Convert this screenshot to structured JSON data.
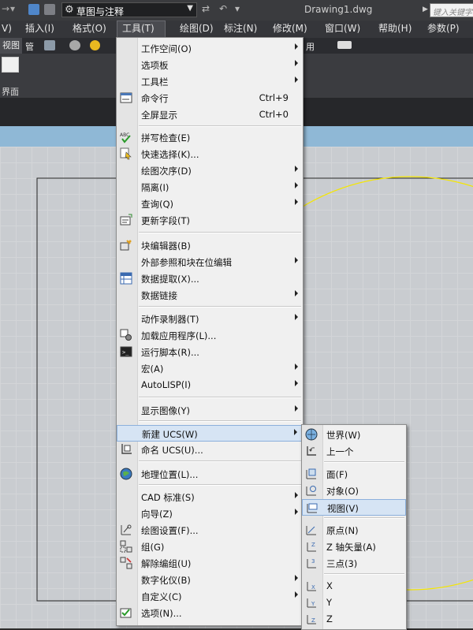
{
  "titlebar": {
    "workspace": "草图与注释",
    "doc_title": "Drawing1.dwg",
    "search_placeholder": "键入关键字"
  },
  "menubar": {
    "items": [
      {
        "label": "V)"
      },
      {
        "label": "插入(I)"
      },
      {
        "label": "格式(O)"
      },
      {
        "label": "工具(T)"
      },
      {
        "label": "绘图(D)"
      },
      {
        "label": "标注(N)"
      },
      {
        "label": "修改(M)"
      },
      {
        "label": "窗口(W)"
      },
      {
        "label": "帮助(H)"
      },
      {
        "label": "参数(P)"
      }
    ]
  },
  "ribbon": {
    "tab_left": "视图",
    "tab_manage": "管",
    "tab_use": "用",
    "panel_label": "界面"
  },
  "tools_menu": [
    {
      "label": "工作空间(O)",
      "arrow": true
    },
    {
      "label": "选项板",
      "arrow": true
    },
    {
      "label": "工具栏",
      "arrow": true
    },
    {
      "label": "命令行",
      "shortcut": "Ctrl+9",
      "icon": "command-line-icon"
    },
    {
      "label": "全屏显示",
      "shortcut": "Ctrl+0"
    },
    {
      "label": "拼写检查(E)",
      "icon": "spell-check-icon"
    },
    {
      "label": "快速选择(K)...",
      "icon": "quick-select-icon"
    },
    {
      "label": "绘图次序(D)",
      "arrow": true
    },
    {
      "label": "隔离(I)",
      "arrow": true
    },
    {
      "label": "查询(Q)",
      "arrow": true
    },
    {
      "label": "更新字段(T)",
      "icon": "update-field-icon"
    },
    {
      "label": "块编辑器(B)",
      "icon": "block-editor-icon"
    },
    {
      "label": "外部参照和块在位编辑",
      "arrow": true
    },
    {
      "label": "数据提取(X)...",
      "icon": "data-extraction-icon"
    },
    {
      "label": "数据链接",
      "arrow": true
    },
    {
      "label": "动作录制器(T)",
      "arrow": true
    },
    {
      "label": "加载应用程序(L)...",
      "icon": "load-app-icon"
    },
    {
      "label": "运行脚本(R)...",
      "icon": "run-script-icon"
    },
    {
      "label": "宏(A)",
      "arrow": true
    },
    {
      "label": "AutoLISP(I)",
      "arrow": true
    },
    {
      "label": "显示图像(Y)",
      "arrow": true
    },
    {
      "label": "新建 UCS(W)",
      "arrow": true
    },
    {
      "label": "命名 UCS(U)...",
      "icon": "named-ucs-icon"
    },
    {
      "label": "地理位置(L)...",
      "icon": "geolocation-icon"
    },
    {
      "label": "CAD 标准(S)",
      "arrow": true
    },
    {
      "label": "向导(Z)",
      "arrow": true
    },
    {
      "label": "绘图设置(F)...",
      "icon": "drafting-settings-icon"
    },
    {
      "label": "组(G)",
      "icon": "group-icon"
    },
    {
      "label": "解除编组(U)",
      "icon": "ungroup-icon"
    },
    {
      "label": "数字化仪(B)",
      "arrow": true
    },
    {
      "label": "自定义(C)",
      "arrow": true
    },
    {
      "label": "选项(N)...",
      "icon": "options-icon"
    }
  ],
  "ucs_submenu": [
    {
      "label": "世界(W)",
      "icon": "ucs-world-icon"
    },
    {
      "label": "上一个",
      "icon": "ucs-previous-icon"
    },
    {
      "label": "面(F)",
      "icon": "ucs-face-icon"
    },
    {
      "label": "对象(O)",
      "icon": "ucs-object-icon"
    },
    {
      "label": "视图(V)",
      "icon": "ucs-view-icon"
    },
    {
      "label": "原点(N)",
      "icon": "ucs-origin-icon"
    },
    {
      "label": "Z 轴矢量(A)",
      "icon": "ucs-zaxis-icon"
    },
    {
      "label": "三点(3)",
      "icon": "ucs-3point-icon"
    },
    {
      "label": "X",
      "icon": "ucs-x-icon"
    },
    {
      "label": "Y",
      "icon": "ucs-y-icon"
    },
    {
      "label": "Z",
      "icon": "ucs-z-icon"
    }
  ],
  "colors": {
    "highlight": "#d6e4f4",
    "canvas": "#c9ccd0",
    "circle": "#f5e600"
  }
}
